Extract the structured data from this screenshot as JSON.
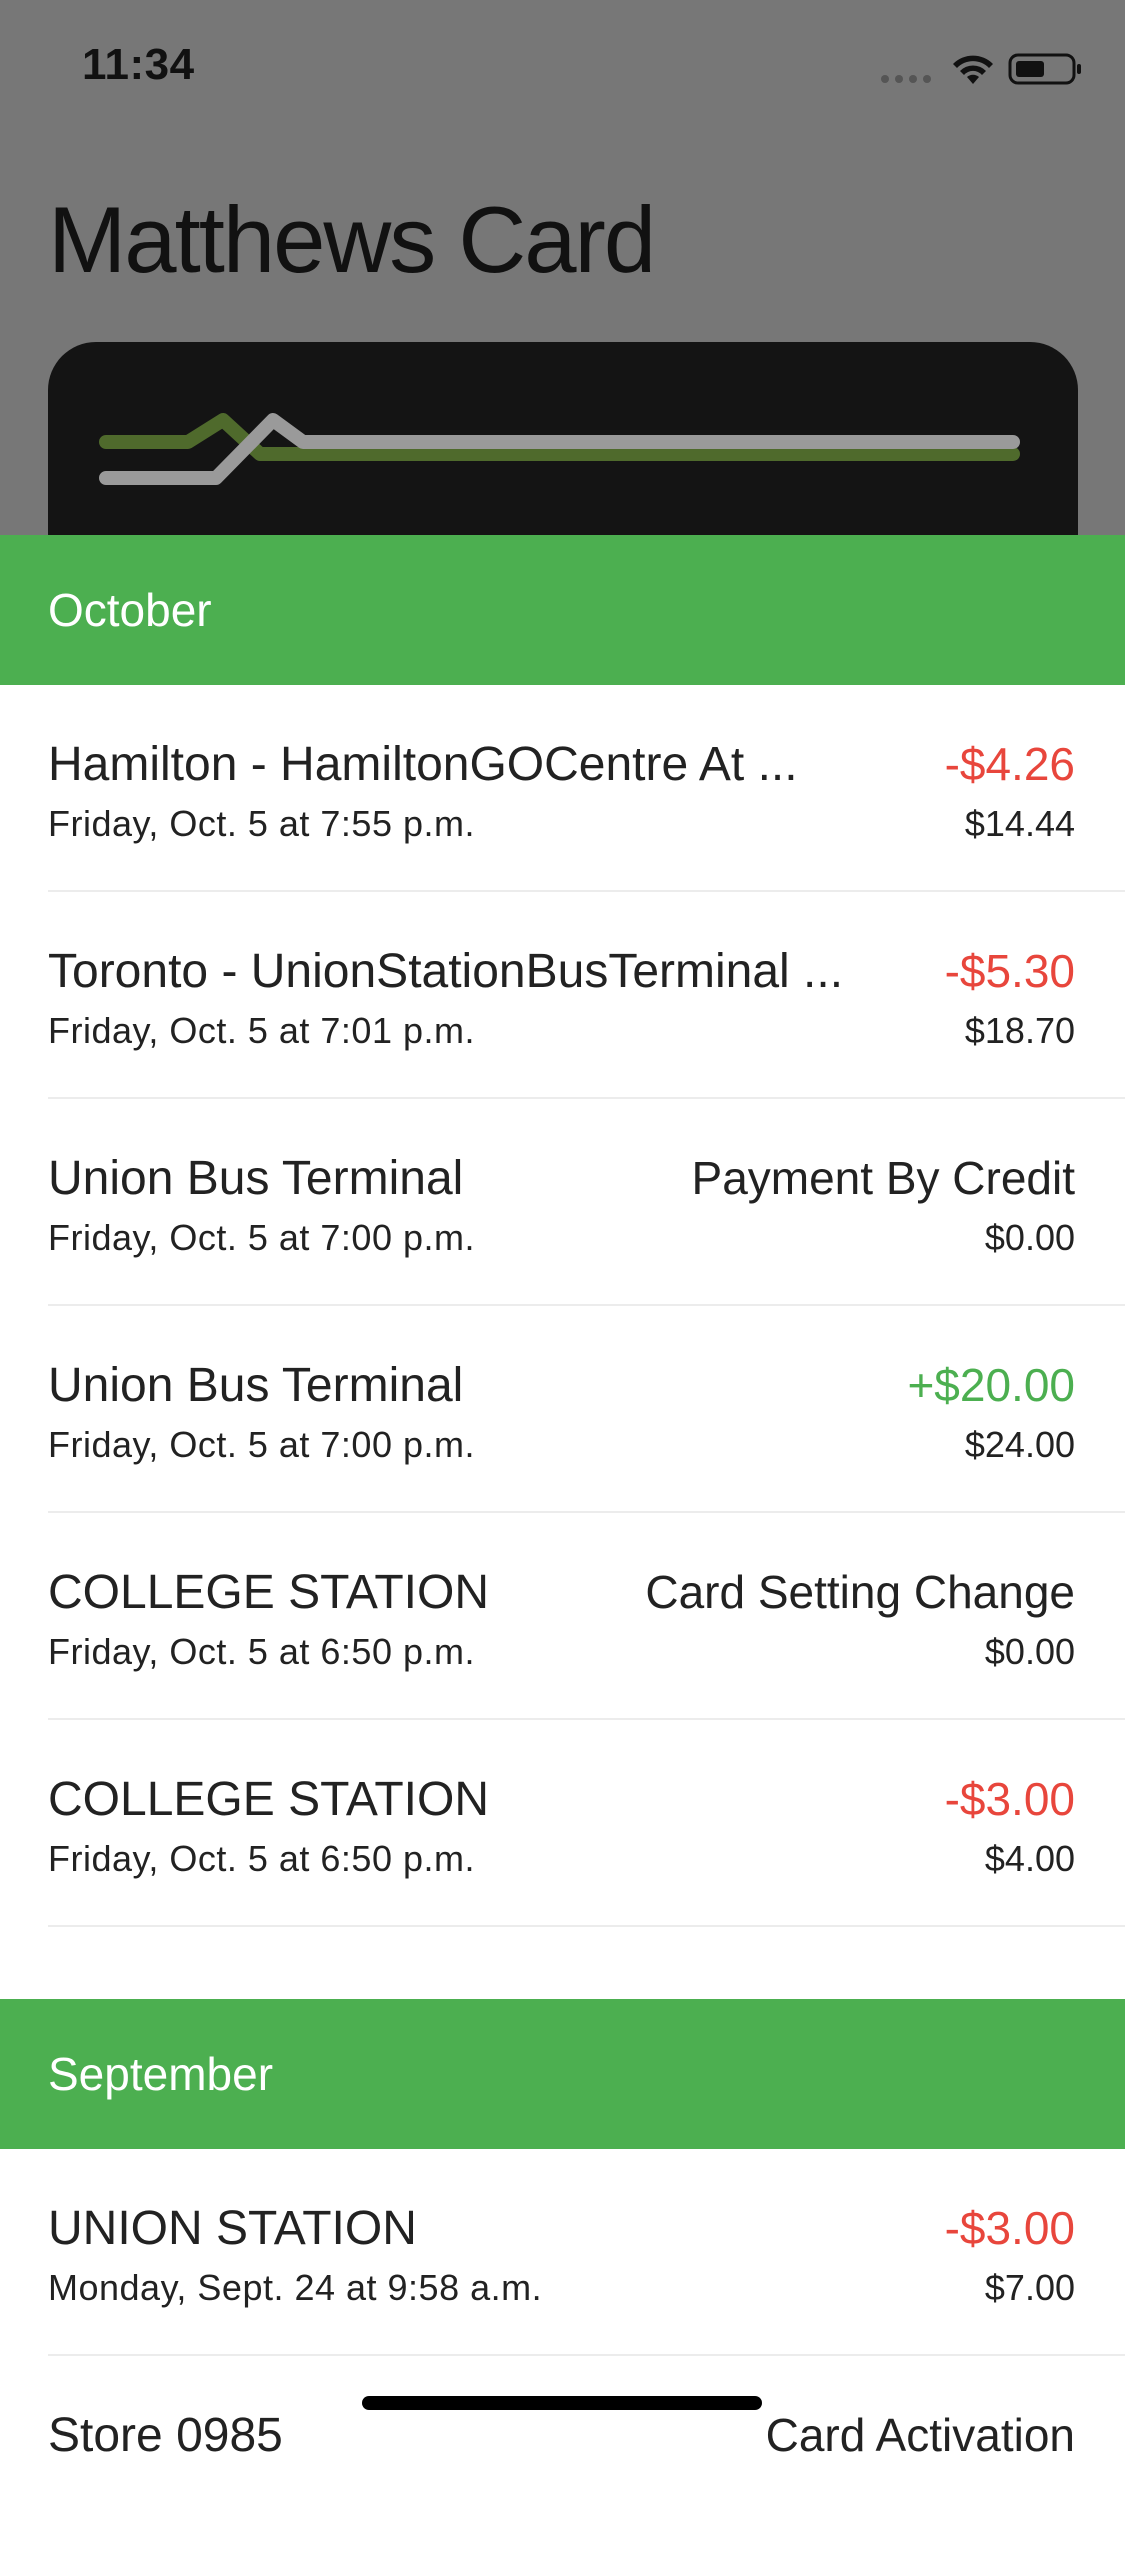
{
  "status_bar": {
    "time": "11:34"
  },
  "header": {
    "title": "Matthews Card"
  },
  "colors": {
    "accent_green": "#4caf50",
    "negative_red": "#e8463c",
    "dim_background": "#777777",
    "card_background": "#141414"
  },
  "months": [
    {
      "label": "October",
      "transactions": [
        {
          "place": "Hamilton - HamiltonGOCentre At ...",
          "date": "Friday, Oct. 5 at 7:55 p.m.",
          "amount": "-$4.26",
          "balance": "$14.44",
          "kind": "neg"
        },
        {
          "place": "Toronto - UnionStationBusTerminal ...",
          "date": "Friday, Oct. 5 at 7:01 p.m.",
          "amount": "-$5.30",
          "balance": "$18.70",
          "kind": "neg"
        },
        {
          "place": "Union Bus Terminal",
          "date": "Friday, Oct. 5 at 7:00 p.m.",
          "amount": "Payment By Credit",
          "balance": "$0.00",
          "kind": "neutral"
        },
        {
          "place": "Union Bus Terminal",
          "date": "Friday, Oct. 5 at 7:00 p.m.",
          "amount": "+$20.00",
          "balance": "$24.00",
          "kind": "pos"
        },
        {
          "place": "COLLEGE STATION",
          "date": "Friday, Oct. 5 at 6:50 p.m.",
          "amount": "Card Setting Change",
          "balance": "$0.00",
          "kind": "neutral"
        },
        {
          "place": "COLLEGE STATION",
          "date": "Friday, Oct. 5 at 6:50 p.m.",
          "amount": "-$3.00",
          "balance": "$4.00",
          "kind": "neg"
        }
      ]
    },
    {
      "label": "September",
      "transactions": [
        {
          "place": "UNION STATION",
          "date": "Monday, Sept. 24 at 9:58 a.m.",
          "amount": "-$3.00",
          "balance": "$7.00",
          "kind": "neg"
        },
        {
          "place": "Store 0985",
          "date": "",
          "amount": "Card Activation",
          "balance": "",
          "kind": "neutral"
        }
      ]
    }
  ]
}
